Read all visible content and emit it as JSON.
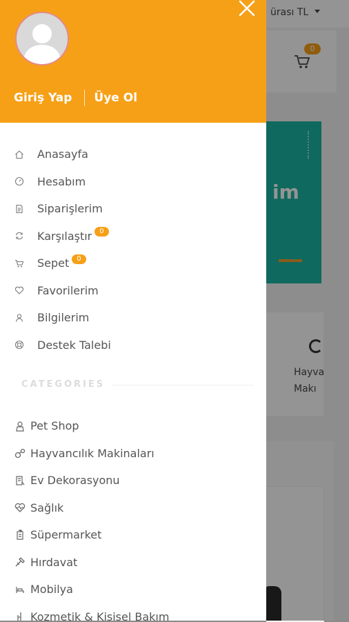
{
  "background": {
    "currency_label": "ürası TL",
    "cart_count": "0",
    "banner_text": "im",
    "card_text_line1": "Hayva",
    "card_text_line2": "Makı"
  },
  "drawer": {
    "login_label": "Giriş Yap",
    "register_label": "Üye Ol",
    "menu": [
      {
        "label": "Anasayfa",
        "icon": "home-icon"
      },
      {
        "label": "Hesabım",
        "icon": "dashboard-icon"
      },
      {
        "label": "Siparişlerim",
        "icon": "document-icon"
      },
      {
        "label": "Karşılaştır",
        "icon": "refresh-icon",
        "badge": "0"
      },
      {
        "label": "Sepet",
        "icon": "cart-icon",
        "badge": "0"
      },
      {
        "label": "Favorilerim",
        "icon": "heart-icon"
      },
      {
        "label": "Bilgilerim",
        "icon": "user-icon"
      },
      {
        "label": "Destek Talebi",
        "icon": "support-icon"
      }
    ],
    "categories_title": "CATEGORIES",
    "categories": [
      {
        "label": "Pet Shop",
        "icon": "pet-icon"
      },
      {
        "label": "Hayvancılık Makinaları",
        "icon": "machinery-icon"
      },
      {
        "label": "Ev Dekorasyonu",
        "icon": "decor-icon"
      },
      {
        "label": "Sağlık",
        "icon": "health-icon"
      },
      {
        "label": "Süpermarket",
        "icon": "supermarket-icon"
      },
      {
        "label": "Hırdavat",
        "icon": "hardware-icon"
      },
      {
        "label": "Mobilya",
        "icon": "furniture-icon"
      },
      {
        "label": "Kozmetik & Kişisel Bakım",
        "icon": "cosmetics-icon"
      }
    ]
  },
  "colors": {
    "accent": "#f6a018",
    "menu_text": "#555555",
    "categories_title": "#dcdcdc"
  }
}
